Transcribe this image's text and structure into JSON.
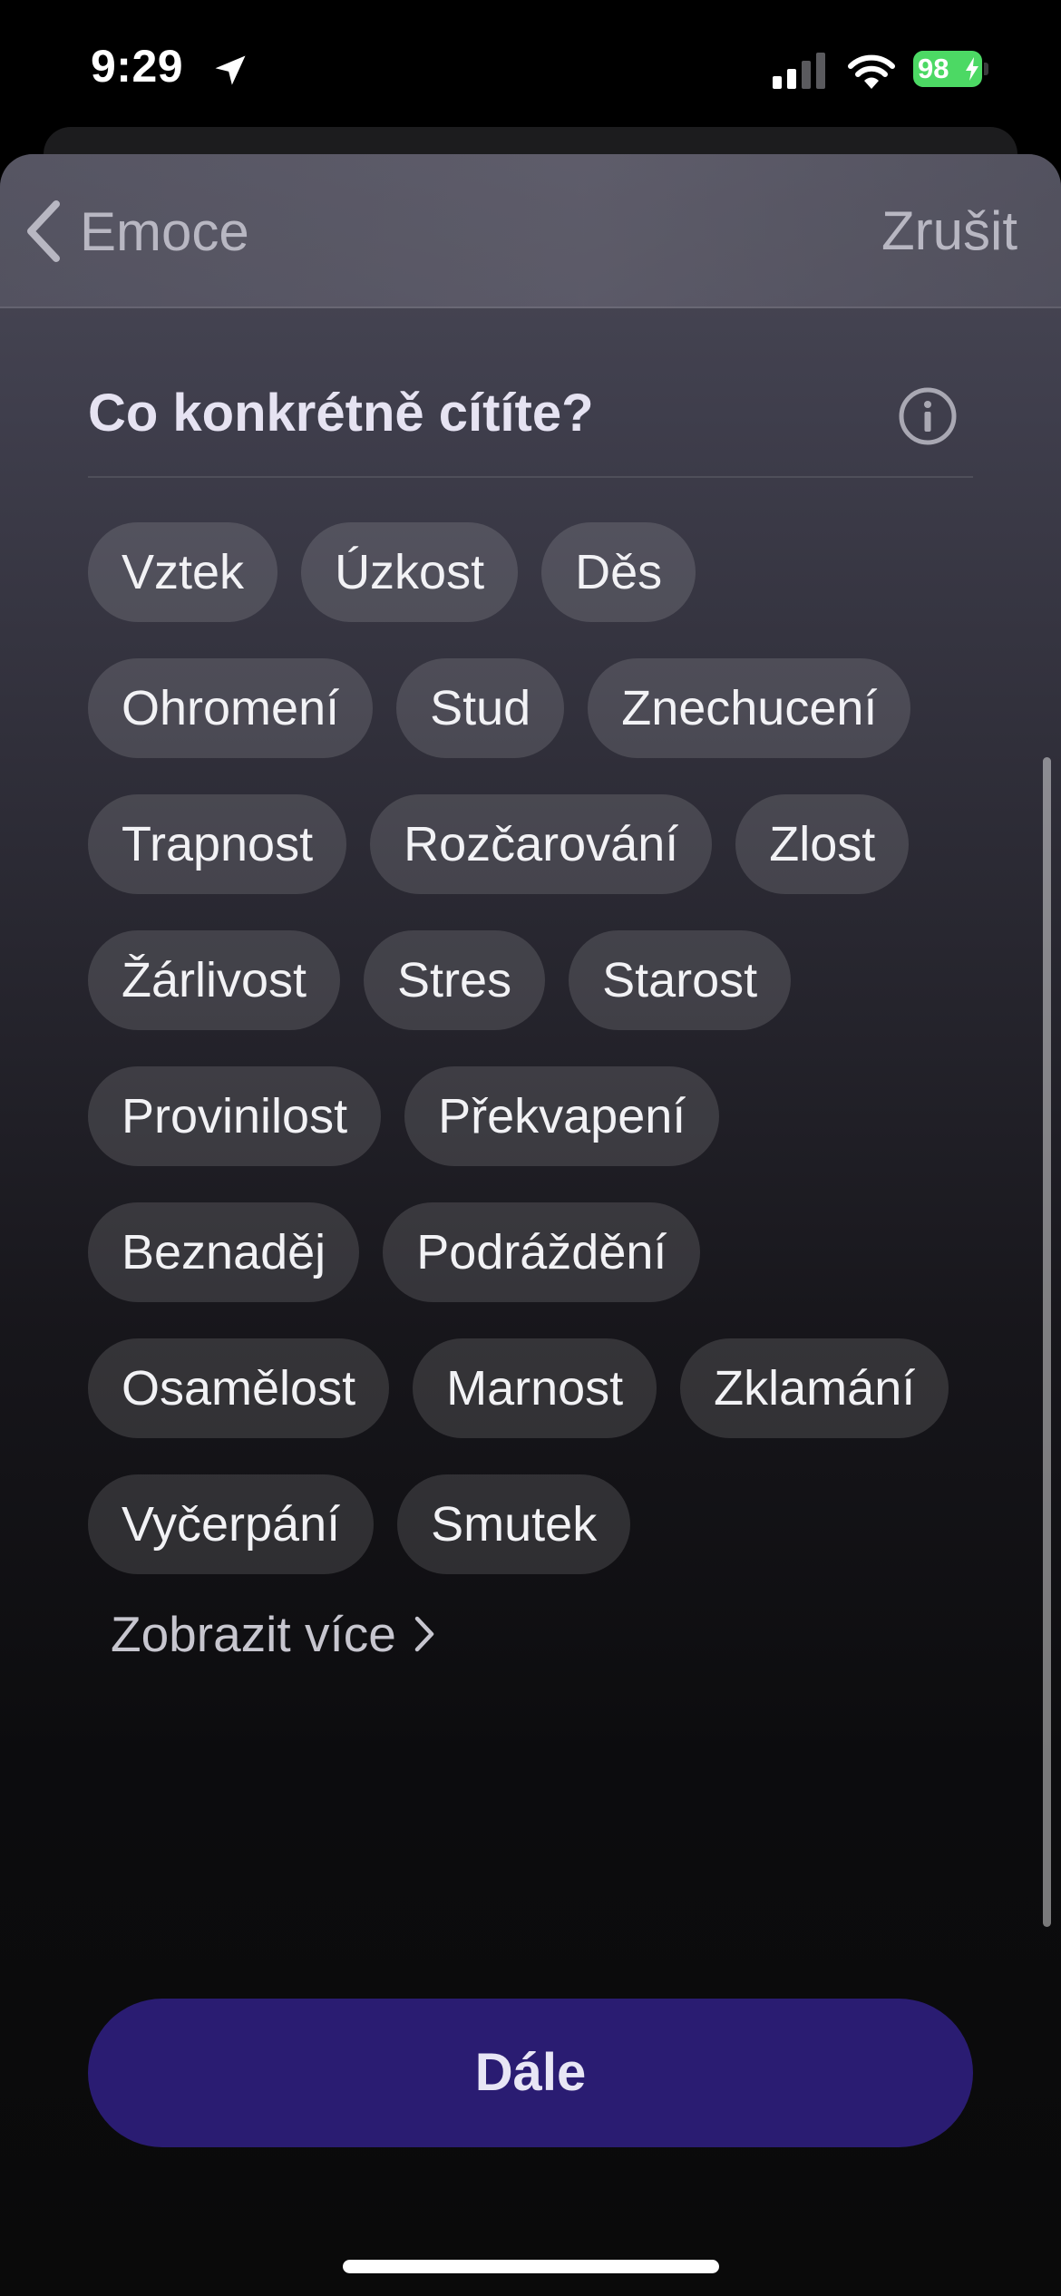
{
  "status_bar": {
    "time": "9:29",
    "battery_percent": "98",
    "icons": [
      "location-arrow-icon",
      "cellular-signal-icon",
      "wifi-icon",
      "battery-charging-icon"
    ]
  },
  "nav": {
    "back_label": "Emoce",
    "cancel_label": "Zrušit"
  },
  "question": {
    "title": "Co konkrétně cítíte?",
    "info_icon": "info-icon"
  },
  "emotions": [
    "Vztek",
    "Úzkost",
    "Děs",
    "Ohromení",
    "Stud",
    "Znechucení",
    "Trapnost",
    "Rozčarování",
    "Zlost",
    "Žárlivost",
    "Stres",
    "Starost",
    "Provinilost",
    "Překvapení",
    "Beznaděj",
    "Podráždění",
    "Osamělost",
    "Marnost",
    "Zklamání",
    "Vyčerpání",
    "Smutek"
  ],
  "show_more_label": "Zobrazit více",
  "next_button_label": "Dále",
  "colors": {
    "primary_button": "#2a1c72",
    "chip_background": "rgba(255,255,255,0.13)",
    "battery": "#4cd964"
  }
}
